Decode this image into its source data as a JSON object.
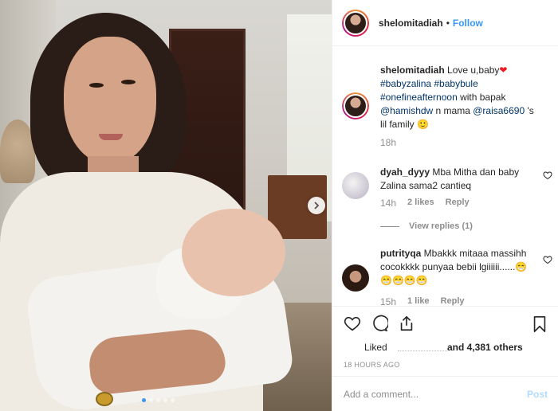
{
  "post": {
    "username": "shelomitadiah",
    "follow_label": "Follow",
    "separator": "•",
    "carousel": {
      "total_slides": 5,
      "active_slide": 1
    }
  },
  "caption": {
    "username": "shelomitadiah",
    "line1": "Love u,baby",
    "heart": "❤",
    "hashtags": "#babyzalina #babybule #onefineafternoon",
    "text_with": " with bapak ",
    "mention1": "@hamishdw",
    "text_n_mama": " n mama ",
    "mention2": "@raisa6690",
    "text_end": " 's lil family 🙂",
    "time": "18h"
  },
  "comments": [
    {
      "username": "dyah_dyyy",
      "text": " Mba Mitha dan baby Zalina sama2 cantieq",
      "time": "14h",
      "likes": "2 likes",
      "reply": "Reply",
      "view_replies": "View replies (1)"
    },
    {
      "username": "putrityqa",
      "text": " Mbakkk mitaaa massihh cocokkkk punyaa bebii lgiiiiii......",
      "emojis": "😁😁😁😁😁",
      "time": "15h",
      "likes": "1 like",
      "reply": "Reply"
    }
  ],
  "actions": {
    "liked_label": "Liked",
    "others_label": "and 4,381 others",
    "timestamp": "18 HOURS AGO"
  },
  "comment_box": {
    "placeholder": "Add a comment...",
    "post_label": "Post"
  },
  "icons": {
    "like": "heart-icon",
    "comment": "comment-icon",
    "share": "share-icon",
    "save": "bookmark-icon",
    "next": "chevron-right-icon"
  },
  "colors": {
    "link_blue": "#3897f0",
    "mention_blue": "#003569",
    "muted": "#8e8e8e",
    "post_disabled": "#b3dbff",
    "heart_red": "#ed1b24"
  }
}
